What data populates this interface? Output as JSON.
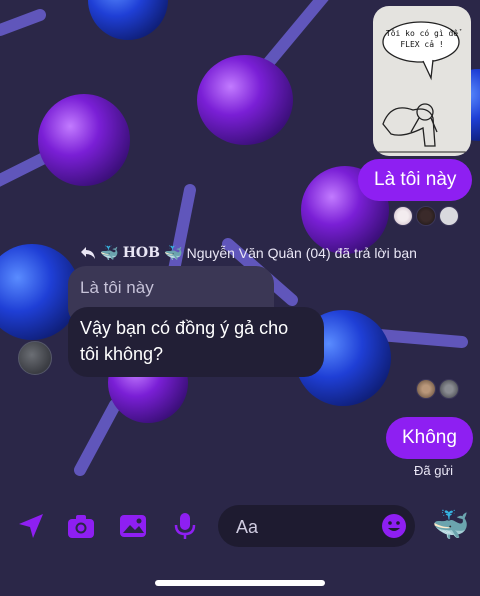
{
  "colors": {
    "background": "#2b2748",
    "accent": "#8e1ff2",
    "received_bubble": "#221f36",
    "quoted_bubble": "#3b3755"
  },
  "sticker": {
    "caption": "Tôi ko có gì để FLEX cả !"
  },
  "messages": {
    "sent_1": "Là tôi này",
    "reply_header": {
      "reply_icon": "reply-arrow-icon",
      "group_name": "HOB",
      "sender_name": "Nguyễn Văn Quân (04)",
      "suffix": "đã trả lời bạn"
    },
    "quoted_text": "Là tôi này",
    "received_line1": "Vậy bạn có đồng ý gả cho",
    "received_line2": "tôi không?",
    "sent_2": "Không",
    "status": "Đã gửi"
  },
  "composer": {
    "placeholder": "Aa",
    "icons": [
      "location-arrow-icon",
      "camera-icon",
      "image-icon",
      "microphone-icon",
      "emoji-icon",
      "whale-icon"
    ]
  }
}
